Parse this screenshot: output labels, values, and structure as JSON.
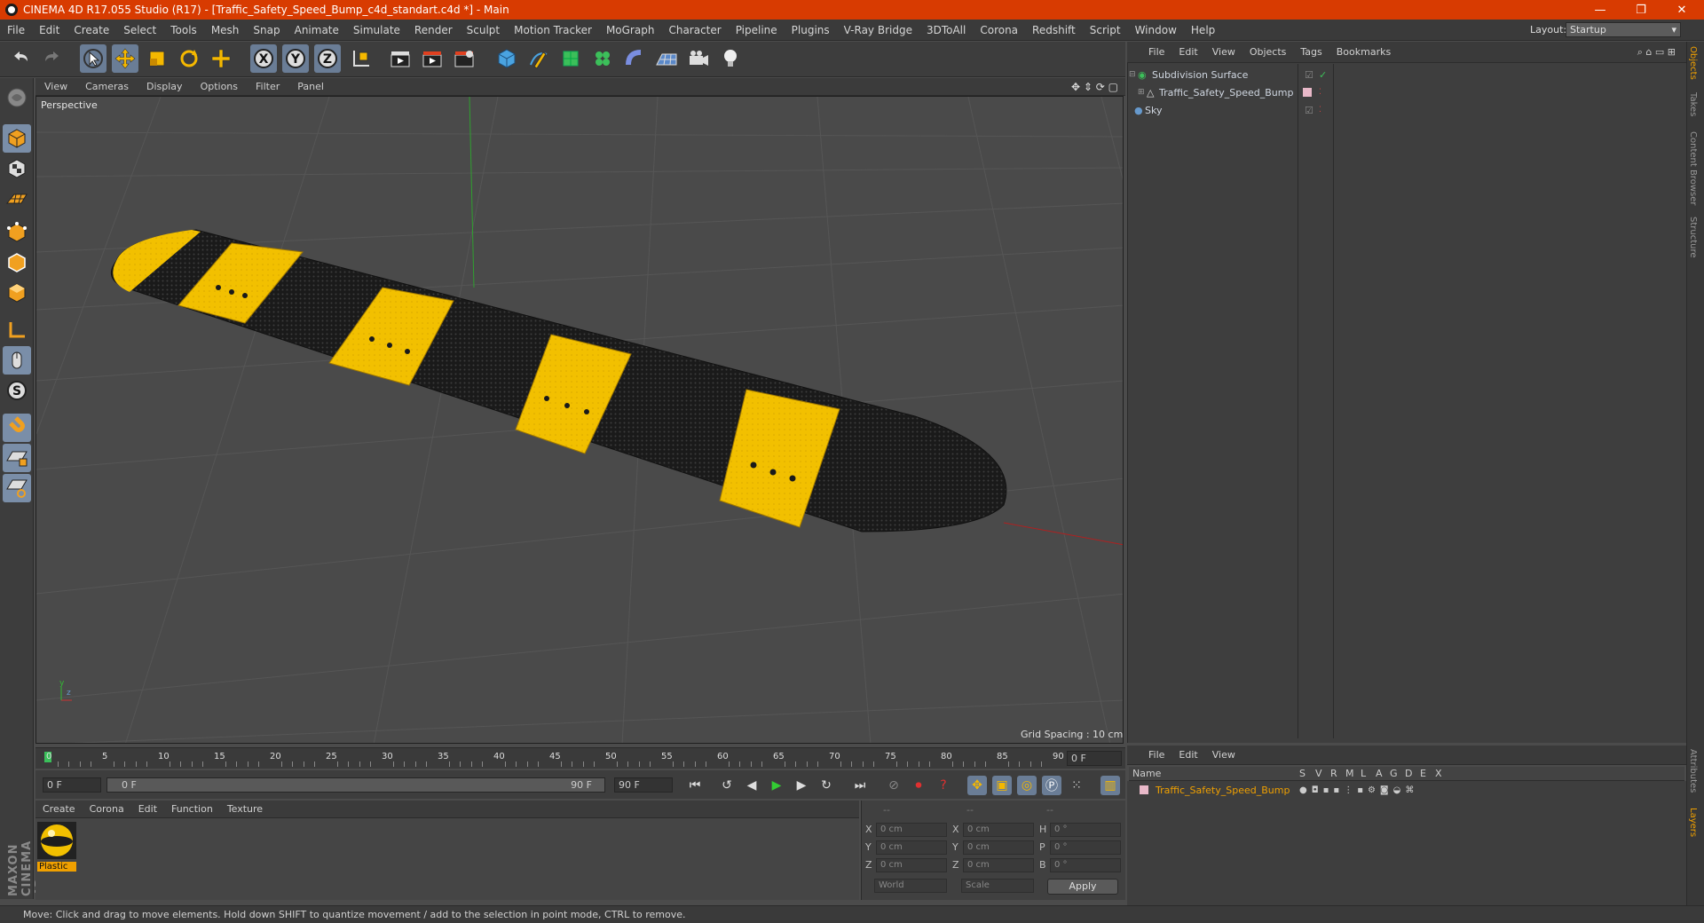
{
  "title_bar": {
    "title": "CINEMA 4D R17.055 Studio (R17) - [Traffic_Safety_Speed_Bump_c4d_standart.c4d *] - Main",
    "minimize": "—",
    "restore": "❐",
    "close": "✕"
  },
  "menu": [
    "File",
    "Edit",
    "Create",
    "Select",
    "Tools",
    "Mesh",
    "Snap",
    "Animate",
    "Simulate",
    "Render",
    "Sculpt",
    "Motion Tracker",
    "MoGraph",
    "Character",
    "Pipeline",
    "Plugins",
    "V-Ray Bridge",
    "3DToAll",
    "Corona",
    "Redshift",
    "Script",
    "Window",
    "Help"
  ],
  "layout": {
    "label": "Layout:",
    "value": "Startup"
  },
  "viewport": {
    "menu": [
      "View",
      "Cameras",
      "Display",
      "Options",
      "Filter",
      "Panel"
    ],
    "label": "Perspective",
    "grid_spacing": "Grid Spacing : 10 cm"
  },
  "timeline": {
    "ticks": [
      "0",
      "5",
      "10",
      "15",
      "20",
      "25",
      "30",
      "35",
      "40",
      "45",
      "50",
      "55",
      "60",
      "65",
      "70",
      "75",
      "80",
      "85",
      "90"
    ],
    "current_frame": "0 F",
    "start": "0 F",
    "range_start": "0 F",
    "range_end": "90 F",
    "end": "90 F"
  },
  "material_panel": {
    "menu": [
      "Create",
      "Corona",
      "Edit",
      "Function",
      "Texture"
    ],
    "material_name": "Plastic"
  },
  "coordinates": {
    "headers": [
      "--",
      "--",
      "--"
    ],
    "rows": [
      {
        "a": "X",
        "av": "0 cm",
        "b": "X",
        "bv": "0 cm",
        "c": "H",
        "cv": "0 °"
      },
      {
        "a": "Y",
        "av": "0 cm",
        "b": "Y",
        "bv": "0 cm",
        "c": "P",
        "cv": "0 °"
      },
      {
        "a": "Z",
        "av": "0 cm",
        "b": "Z",
        "bv": "0 cm",
        "c": "B",
        "cv": "0 °"
      }
    ],
    "mode": "World",
    "scale": "Scale",
    "apply": "Apply"
  },
  "objects_panel": {
    "menu": [
      "File",
      "Edit",
      "View",
      "Objects",
      "Tags",
      "Bookmarks"
    ],
    "items": [
      {
        "name": "Subdivision Surface"
      },
      {
        "name": "Traffic_Safety_Speed_Bump"
      },
      {
        "name": "Sky"
      }
    ]
  },
  "right_tabs": [
    "Objects",
    "Takes",
    "Content Browser",
    "Structure",
    "Attributes",
    "Layers"
  ],
  "layers_panel": {
    "menu": [
      "File",
      "Edit",
      "View"
    ],
    "header": {
      "name": "Name",
      "cols": [
        "S",
        "V",
        "R",
        "M",
        "L",
        "A",
        "G",
        "D",
        "E",
        "X"
      ]
    },
    "layer_name": "Traffic_Safety_Speed_Bump"
  },
  "status": "Move: Click and drag to move elements. Hold down SHIFT to quantize movement / add to the selection in point mode, CTRL to remove.",
  "brand": "MAXON CINEMA 4D",
  "colors": {
    "accent": "#d83b01",
    "yellow": "#f5c400",
    "highlight": "#f0a000"
  }
}
